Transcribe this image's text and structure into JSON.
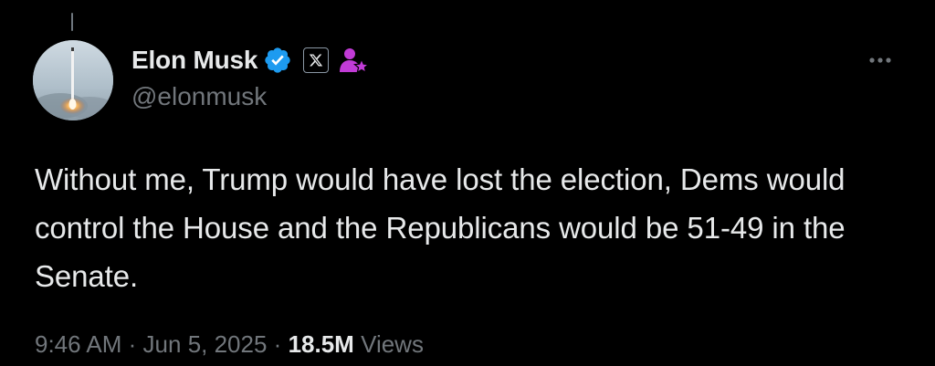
{
  "tweet": {
    "author": {
      "display_name": "Elon Musk",
      "handle": "@elonmusk",
      "verified_icon": "verified-badge-icon",
      "affiliate_icon": "x-logo-icon",
      "affiliation_icon": "government-person-icon"
    },
    "text": "Without me, Trump would have lost the election, Dems would control the House and the Republicans would be 51-49 in the Senate.",
    "meta": {
      "time": "9:46 AM",
      "separator": "·",
      "date": "Jun 5, 2025",
      "views_count": "18.5M",
      "views_label": "Views"
    }
  },
  "colors": {
    "background": "#000000",
    "text_primary": "#e7e9ea",
    "text_secondary": "#71767b",
    "verified_blue": "#1d9bf0",
    "affiliation_purple": "#c13bd6"
  }
}
